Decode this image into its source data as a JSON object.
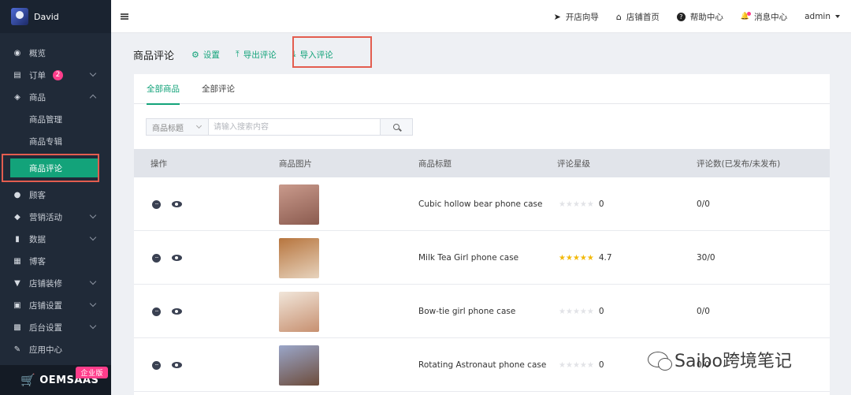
{
  "user": {
    "name": "David"
  },
  "sidebar": {
    "items": [
      {
        "label": "概览",
        "icon": "dashboard-icon",
        "glyph": "◉"
      },
      {
        "label": "订单",
        "icon": "order-icon",
        "glyph": "▤",
        "badge": "2"
      },
      {
        "label": "商品",
        "icon": "product-icon",
        "glyph": "◈"
      },
      {
        "label": "顾客",
        "icon": "customer-icon",
        "glyph": "●"
      },
      {
        "label": "营销活动",
        "icon": "tag-icon",
        "glyph": "◆"
      },
      {
        "label": "数据",
        "icon": "bar-chart-icon",
        "glyph": "▮"
      },
      {
        "label": "博客",
        "icon": "blog-icon",
        "glyph": "▦"
      },
      {
        "label": "店铺装修",
        "icon": "paint-roller-icon",
        "glyph": "▼"
      },
      {
        "label": "店铺设置",
        "icon": "store-settings-icon",
        "glyph": "▣"
      },
      {
        "label": "后台设置",
        "icon": "admin-settings-icon",
        "glyph": "▩"
      },
      {
        "label": "应用中心",
        "icon": "wrench-icon",
        "glyph": "✎"
      }
    ],
    "sub_items": {
      "product_management": "商品管理",
      "product_topic": "商品专辑",
      "product_reviews": "商品评论"
    },
    "logo": "OEMSAAS",
    "edition": "企业版"
  },
  "topbar": {
    "links": [
      {
        "label": "开店向导",
        "icon": "paper-plane-icon",
        "glyph": "➤"
      },
      {
        "label": "店铺首页",
        "icon": "home-icon",
        "glyph": "⌂"
      },
      {
        "label": "帮助中心",
        "icon": "help-icon",
        "glyph": "?"
      },
      {
        "label": "消息中心",
        "icon": "bell-icon",
        "glyph": "🔔"
      }
    ],
    "user": "admin"
  },
  "page": {
    "title": "商品评论",
    "actions": {
      "settings": "设置",
      "export": "导出评论",
      "import": "导入评论"
    }
  },
  "tabs": [
    {
      "label": "全部商品",
      "active": true
    },
    {
      "label": "全部评论",
      "active": false
    }
  ],
  "search": {
    "field": "商品标题",
    "placeholder": "请输入搜索内容"
  },
  "table": {
    "headers": [
      "操作",
      "商品图片",
      "商品标题",
      "评论星级",
      "评论数(已发布/未发布)"
    ],
    "rows": [
      {
        "title": "Cubic hollow bear phone case",
        "stars": 0,
        "rating": "0",
        "count": "0/0",
        "thumb_colors": [
          "#c99a8c",
          "#8b5b4f"
        ]
      },
      {
        "title": "Milk Tea Girl phone case",
        "stars": 5,
        "rating": "4.7",
        "count": "30/0",
        "thumb_colors": [
          "#b7753e",
          "#e7d3bd"
        ]
      },
      {
        "title": "Bow-tie girl phone case",
        "stars": 0,
        "rating": "0",
        "count": "0/0",
        "thumb_colors": [
          "#f1e6da",
          "#c79070"
        ]
      },
      {
        "title": "Rotating Astronaut phone case",
        "stars": 0,
        "rating": "0",
        "count": "0/0",
        "thumb_colors": [
          "#9aa6c9",
          "#6d4c3b"
        ]
      }
    ]
  },
  "watermark": "Saibo跨境笔记",
  "colors": {
    "accent": "#13a37a",
    "sidebar": "#202a38",
    "highlight": "#e35d4f",
    "badge": "#ff3d8b",
    "star": "#f2b90b"
  }
}
